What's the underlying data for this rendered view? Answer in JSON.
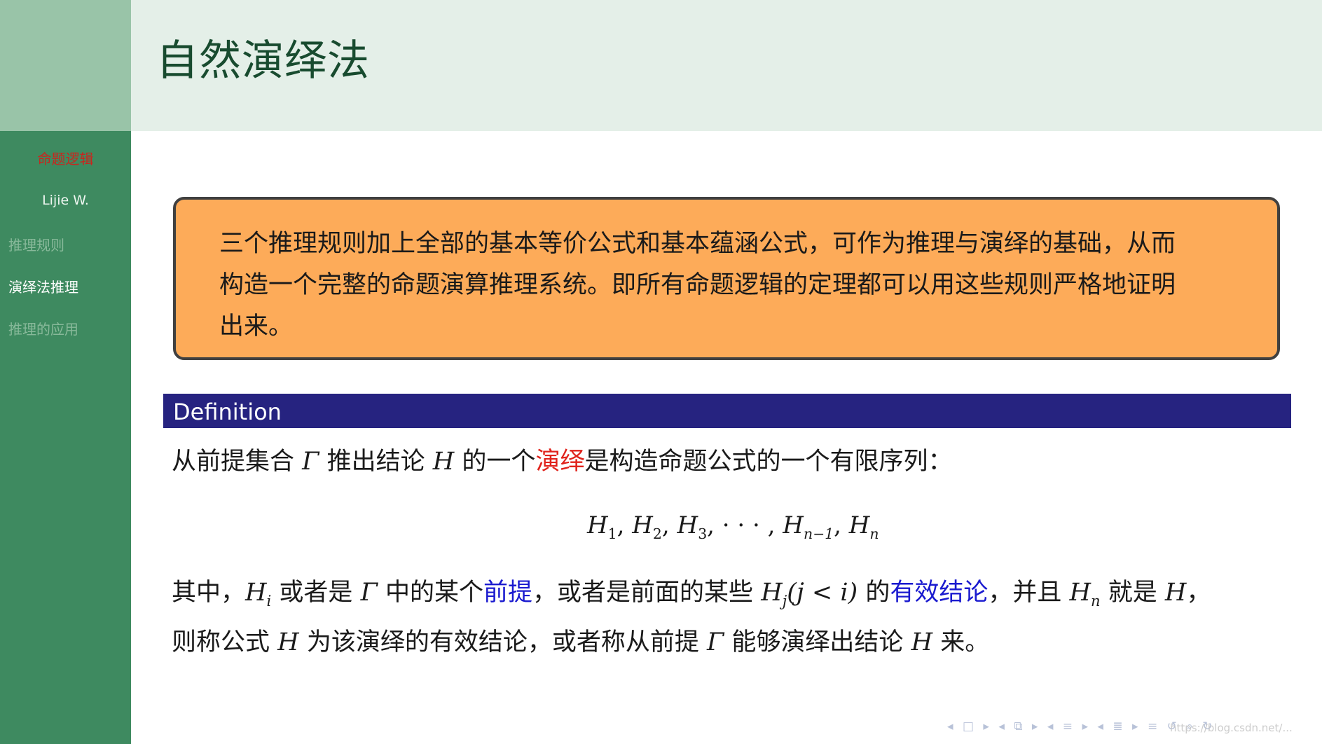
{
  "header": {
    "title": "自然演绎法"
  },
  "sidebar": {
    "title": "命题逻辑",
    "author": "Lijie W.",
    "items": [
      {
        "label": "推理规则"
      },
      {
        "label": "演绎法推理"
      },
      {
        "label": "推理的应用"
      }
    ]
  },
  "orange_block": {
    "line1": "三个推理规则加上全部的基本等价公式和基本蕴涵公式，可作为推理与演绎的基础，从而",
    "line2": "构造一个完整的命题演算推理系统。即所有命题逻辑的定理都可以用这些规则严格地证明",
    "line3": "出来。"
  },
  "definition": {
    "title": "Definition",
    "l1_a": "从前提集合",
    "l1_gamma": "Γ",
    "l1_b": "推出结论",
    "l1_h": "H",
    "l1_c": "的一个",
    "l1_red": "演绎",
    "l1_d": "是构造命题公式的一个有限序列：",
    "f_h": "H",
    "f_sub1": "1",
    "f_sub2": "2",
    "f_sub3": "3",
    "f_dots": "· · ·",
    "f_subn1": "n−1",
    "f_subn": "n",
    "f_sep": ",",
    "p2_a": "其中，",
    "p2_h": "H",
    "p2_i": "i",
    "p2_b": "或者是",
    "p2_gamma": "Γ",
    "p2_c": "中的某个",
    "p2_blue1": "前提",
    "p2_d": "，或者是前面的某些",
    "p2_hj": "H",
    "p2_j": "j",
    "p2_cond": "(j < i)",
    "p2_e": "的",
    "p2_blue2": "有效结论",
    "p2_f": "，并且",
    "p2_hn": "H",
    "p2_n": "n",
    "p2_g": "就是",
    "p2_h2": "H",
    "p2_comma": "，",
    "p3_a": "则称公式",
    "p3_h": "H",
    "p3_b": "为该演绎的有效结论，或者称从前提",
    "p3_gamma": "Γ",
    "p3_c": "能够演绎出结论",
    "p3_h2": "H",
    "p3_d": "来。"
  },
  "nav": {
    "first": "◂",
    "frame": "□",
    "next": "▸",
    "prev_sub": "◂",
    "sub": "⧉",
    "next_sub": "▸",
    "prev_sec": "◂",
    "sec": "≡",
    "next_sec": "▸",
    "prev_part": "◂",
    "part": "≣",
    "next_part": "▸",
    "outline": "≡",
    "undo": "↺",
    "search": "⌕",
    "redo": "↻"
  },
  "watermark": "https://blog.csdn.net/..."
}
